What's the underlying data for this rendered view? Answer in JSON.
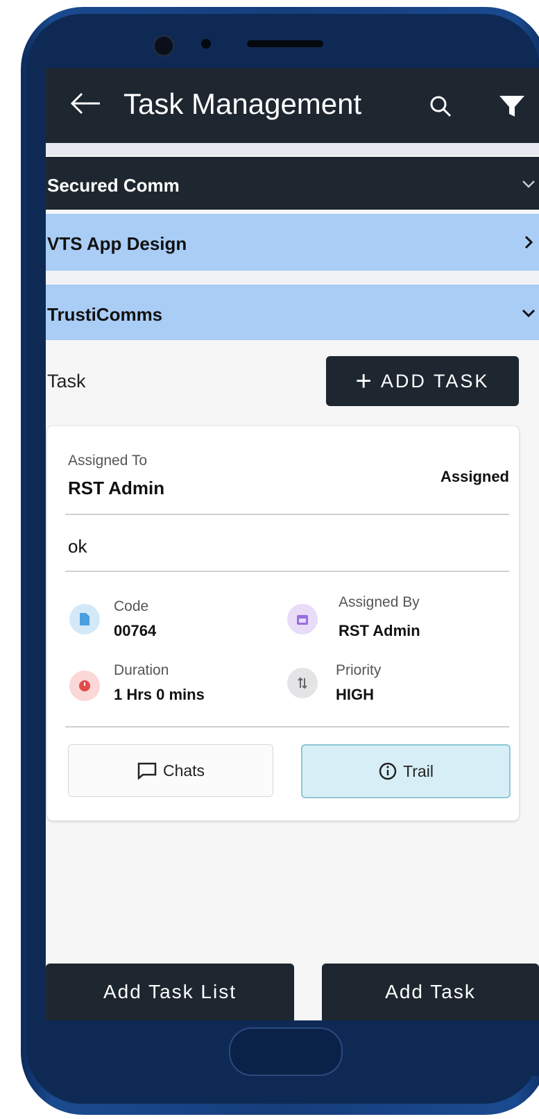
{
  "appbar": {
    "title": "Task Management",
    "back_icon": "arrow-left-icon",
    "search_icon": "search-icon",
    "filter_icon": "filter-icon"
  },
  "sections": [
    {
      "label": "Secured Comm",
      "chevron": "chevron-down-icon"
    },
    {
      "label": "VTS App Design",
      "chevron": "chevron-right-icon"
    },
    {
      "label": "TrustiComms",
      "chevron": "chevron-down-icon"
    }
  ],
  "task_header": {
    "label": "Task",
    "add_button": "ADD TASK"
  },
  "task_card": {
    "assigned_to_label": "Assigned To",
    "assigned_to": "RST Admin",
    "status": "Assigned",
    "description": "ok",
    "code_label": "Code",
    "code": "00764",
    "assigned_by_label": "Assigned By",
    "assigned_by": "RST Admin",
    "duration_label": "Duration",
    "duration": "1 Hrs 0 mins",
    "priority_label": "Priority",
    "priority": "HIGH",
    "chats_label": "Chats",
    "trail_label": "Trail"
  },
  "bottom": {
    "left": "Add Task List",
    "right": "Add Task"
  },
  "colors": {
    "appbar": "#1e2730",
    "accordion_light": "#a9cdf5",
    "phone_frame": "#153e7c",
    "trail_bg": "#d8eef6"
  }
}
